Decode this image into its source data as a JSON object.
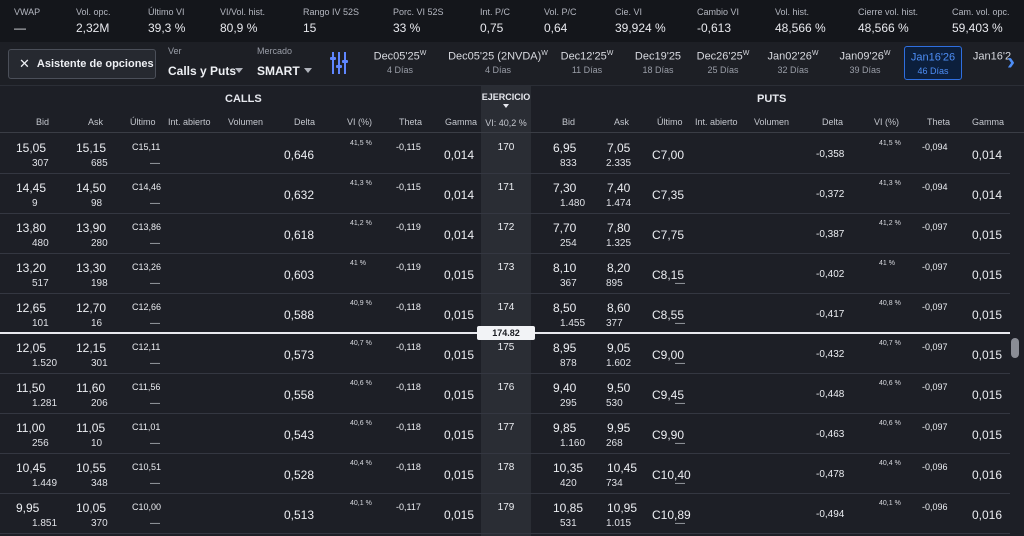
{
  "stats": [
    {
      "label": "VWAP",
      "value": "—"
    },
    {
      "label": "Vol. opc.",
      "value": "2,32M"
    },
    {
      "label": "Último VI",
      "value": "39,3 %"
    },
    {
      "label": "VI/Vol. hist.",
      "value": "80,9 %"
    },
    {
      "label": "Rango IV 52S",
      "value": "15"
    },
    {
      "label": "Porc. VI 52S",
      "value": "33 %"
    },
    {
      "label": "Int. P/C",
      "value": "0,75"
    },
    {
      "label": "Vol. P/C",
      "value": "0,64"
    },
    {
      "label": "Cie. VI",
      "value": "39,924 %"
    },
    {
      "label": "Cambio VI",
      "value": "-0,613"
    },
    {
      "label": "Vol. hist.",
      "value": "48,566 %"
    },
    {
      "label": "Cierre vol. hist.",
      "value": "48,566 %"
    },
    {
      "label": "Cam. vol. opc.",
      "value": "59,403 %"
    }
  ],
  "toolbar": {
    "wizard_icon": "close-x-icon",
    "wizard_label": "Asistente de opciones",
    "view_label": "Ver",
    "view_value": "Calls y Puts",
    "market_label": "Mercado",
    "market_value": "SMART",
    "filter_icon": "filter-sliders-icon",
    "next_icon": "chevron-right-icon"
  },
  "expirations": [
    {
      "date": "Dec05'25",
      "sup": "W",
      "days": "4 Días"
    },
    {
      "date": "Dec05'25 (2NVDA)",
      "sup": "W",
      "days": "4 Días"
    },
    {
      "date": "Dec12'25",
      "sup": "W",
      "days": "11 Días"
    },
    {
      "date": "Dec19'25",
      "sup": "",
      "days": "18 Días"
    },
    {
      "date": "Dec26'25",
      "sup": "W",
      "days": "25 Días"
    },
    {
      "date": "Jan02'26",
      "sup": "W",
      "days": "32 Días"
    },
    {
      "date": "Jan09'26",
      "sup": "W",
      "days": "39 Días"
    },
    {
      "date": "Jan16'26",
      "sup": "",
      "days": "46 Días"
    },
    {
      "date": "Jan16'2",
      "sup": "",
      "days": ""
    }
  ],
  "table": {
    "calls_title": "CALLS",
    "puts_title": "PUTS",
    "strike_title": "EJERCICIO",
    "vi_label": "VI: 40,2 %",
    "columns": [
      "Bid",
      "Ask",
      "Último",
      "Int. abierto",
      "Volumen",
      "Delta",
      "VI (%)",
      "Theta",
      "Gamma",
      "Bid",
      "Ask",
      "Último",
      "Int. abierto",
      "Volumen",
      "Delta",
      "VI (%)",
      "Theta",
      "Gamma"
    ]
  },
  "underlying_price": "174.82",
  "rows": [
    {
      "strike": "170",
      "c_bid": "15,05",
      "c_bid_sz": "307",
      "c_ask": "15,15",
      "c_ask_sz": "685",
      "c_last": "C15,11",
      "c_last2": "—",
      "c_delta": "0,646",
      "c_vi": "41,5 %",
      "c_theta": "-0,115",
      "c_gamma": "0,014",
      "p_bid": "6,95",
      "p_bid_sz": "833",
      "p_ask": "7,05",
      "p_ask_sz": "2.335",
      "p_last": "C7,00",
      "p_last2": "",
      "p_delta": "-0,358",
      "p_vi": "41,5 %",
      "p_theta": "-0,094",
      "p_gamma": "0,014"
    },
    {
      "strike": "171",
      "c_bid": "14,45",
      "c_bid_sz": "9",
      "c_ask": "14,50",
      "c_ask_sz": "98",
      "c_last": "C14,46",
      "c_last2": "—",
      "c_delta": "0,632",
      "c_vi": "41,3 %",
      "c_theta": "-0,115",
      "c_gamma": "0,014",
      "p_bid": "7,30",
      "p_bid_sz": "1.480",
      "p_ask": "7,40",
      "p_ask_sz": "1.474",
      "p_last": "C7,35",
      "p_last2": "",
      "p_delta": "-0,372",
      "p_vi": "41,3 %",
      "p_theta": "-0,094",
      "p_gamma": "0,014"
    },
    {
      "strike": "172",
      "c_bid": "13,80",
      "c_bid_sz": "480",
      "c_ask": "13,90",
      "c_ask_sz": "280",
      "c_last": "C13,86",
      "c_last2": "—",
      "c_delta": "0,618",
      "c_vi": "41,2 %",
      "c_theta": "-0,119",
      "c_gamma": "0,014",
      "p_bid": "7,70",
      "p_bid_sz": "254",
      "p_ask": "7,80",
      "p_ask_sz": "1.325",
      "p_last": "C7,75",
      "p_last2": "",
      "p_delta": "-0,387",
      "p_vi": "41,2 %",
      "p_theta": "-0,097",
      "p_gamma": "0,015"
    },
    {
      "strike": "173",
      "c_bid": "13,20",
      "c_bid_sz": "517",
      "c_ask": "13,30",
      "c_ask_sz": "198",
      "c_last": "C13,26",
      "c_last2": "—",
      "c_delta": "0,603",
      "c_vi": "41 %",
      "c_theta": "-0,119",
      "c_gamma": "0,015",
      "p_bid": "8,10",
      "p_bid_sz": "367",
      "p_ask": "8,20",
      "p_ask_sz": "895",
      "p_last": "C8,15",
      "p_last2": "—",
      "p_delta": "-0,402",
      "p_vi": "41 %",
      "p_theta": "-0,097",
      "p_gamma": "0,015"
    },
    {
      "strike": "174",
      "c_bid": "12,65",
      "c_bid_sz": "101",
      "c_ask": "12,70",
      "c_ask_sz": "16",
      "c_last": "C12,66",
      "c_last2": "—",
      "c_delta": "0,588",
      "c_vi": "40,9 %",
      "c_theta": "-0,118",
      "c_gamma": "0,015",
      "p_bid": "8,50",
      "p_bid_sz": "1.455",
      "p_ask": "8,60",
      "p_ask_sz": "377",
      "p_last": "C8,55",
      "p_last2": "—",
      "p_delta": "-0,417",
      "p_vi": "40,8 %",
      "p_theta": "-0,097",
      "p_gamma": "0,015"
    },
    {
      "strike": "175",
      "c_bid": "12,05",
      "c_bid_sz": "1.520",
      "c_ask": "12,15",
      "c_ask_sz": "301",
      "c_last": "C12,11",
      "c_last2": "—",
      "c_delta": "0,573",
      "c_vi": "40,7 %",
      "c_theta": "-0,118",
      "c_gamma": "0,015",
      "p_bid": "8,95",
      "p_bid_sz": "878",
      "p_ask": "9,05",
      "p_ask_sz": "1.602",
      "p_last": "C9,00",
      "p_last2": "—",
      "p_delta": "-0,432",
      "p_vi": "40,7 %",
      "p_theta": "-0,097",
      "p_gamma": "0,015"
    },
    {
      "strike": "176",
      "c_bid": "11,50",
      "c_bid_sz": "1.281",
      "c_ask": "11,60",
      "c_ask_sz": "206",
      "c_last": "C11,56",
      "c_last2": "—",
      "c_delta": "0,558",
      "c_vi": "40,6 %",
      "c_theta": "-0,118",
      "c_gamma": "0,015",
      "p_bid": "9,40",
      "p_bid_sz": "295",
      "p_ask": "9,50",
      "p_ask_sz": "530",
      "p_last": "C9,45",
      "p_last2": "—",
      "p_delta": "-0,448",
      "p_vi": "40,6 %",
      "p_theta": "-0,097",
      "p_gamma": "0,015"
    },
    {
      "strike": "177",
      "c_bid": "11,00",
      "c_bid_sz": "256",
      "c_ask": "11,05",
      "c_ask_sz": "10",
      "c_last": "C11,01",
      "c_last2": "—",
      "c_delta": "0,543",
      "c_vi": "40,6 %",
      "c_theta": "-0,118",
      "c_gamma": "0,015",
      "p_bid": "9,85",
      "p_bid_sz": "1.160",
      "p_ask": "9,95",
      "p_ask_sz": "268",
      "p_last": "C9,90",
      "p_last2": "—",
      "p_delta": "-0,463",
      "p_vi": "40,6 %",
      "p_theta": "-0,097",
      "p_gamma": "0,015"
    },
    {
      "strike": "178",
      "c_bid": "10,45",
      "c_bid_sz": "1.449",
      "c_ask": "10,55",
      "c_ask_sz": "348",
      "c_last": "C10,51",
      "c_last2": "—",
      "c_delta": "0,528",
      "c_vi": "40,4 %",
      "c_theta": "-0,118",
      "c_gamma": "0,015",
      "p_bid": "10,35",
      "p_bid_sz": "420",
      "p_ask": "10,45",
      "p_ask_sz": "734",
      "p_last": "C10,40",
      "p_last2": "—",
      "p_delta": "-0,478",
      "p_vi": "40,4 %",
      "p_theta": "-0,096",
      "p_gamma": "0,016"
    },
    {
      "strike": "179",
      "c_bid": "9,95",
      "c_bid_sz": "1.851",
      "c_ask": "10,05",
      "c_ask_sz": "370",
      "c_last": "C10,00",
      "c_last2": "—",
      "c_delta": "0,513",
      "c_vi": "40,1 %",
      "c_theta": "-0,117",
      "c_gamma": "0,015",
      "p_bid": "10,85",
      "p_bid_sz": "531",
      "p_ask": "10,95",
      "p_ask_sz": "1.015",
      "p_last": "C10,89",
      "p_last2": "—",
      "p_delta": "-0,494",
      "p_vi": "40,1 %",
      "p_theta": "-0,096",
      "p_gamma": "0,016"
    }
  ],
  "colors": {
    "accent": "#4d8df5",
    "positive": "#2fce6f",
    "negative": "#f05050",
    "background": "#1a1c22"
  }
}
